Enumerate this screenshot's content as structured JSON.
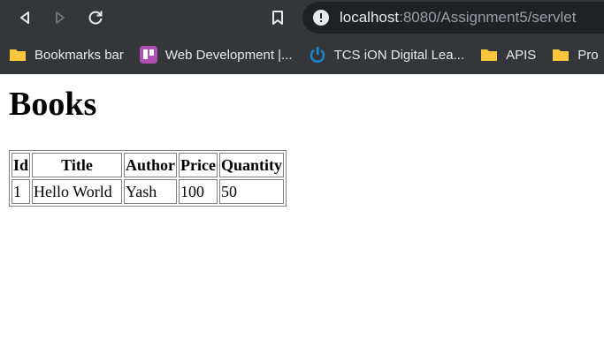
{
  "browser": {
    "url_host": "localhost",
    "url_path": ":8080/Assignment5/servlet",
    "bookmarks": [
      {
        "label": "Bookmarks bar",
        "icon": "folder-icon"
      },
      {
        "label": "Web Development |...",
        "icon": "trello-icon"
      },
      {
        "label": "TCS iON Digital Lea...",
        "icon": "power-icon"
      },
      {
        "label": "APIS",
        "icon": "folder-icon"
      },
      {
        "label": "Pro",
        "icon": "folder-icon"
      }
    ],
    "colors": {
      "chrome_bg": "#35363a",
      "omnibox_bg": "#202124",
      "folder_yellow": "#f9c53d",
      "trello_purple": "#b04fb6",
      "power_blue": "#1a86d4"
    }
  },
  "page": {
    "title": "Books",
    "table": {
      "headers": [
        "Id",
        "Title",
        "Author",
        "Price",
        "Quantity"
      ],
      "rows": [
        [
          "1",
          "Hello World",
          "Yash",
          "100",
          "50"
        ]
      ]
    }
  }
}
